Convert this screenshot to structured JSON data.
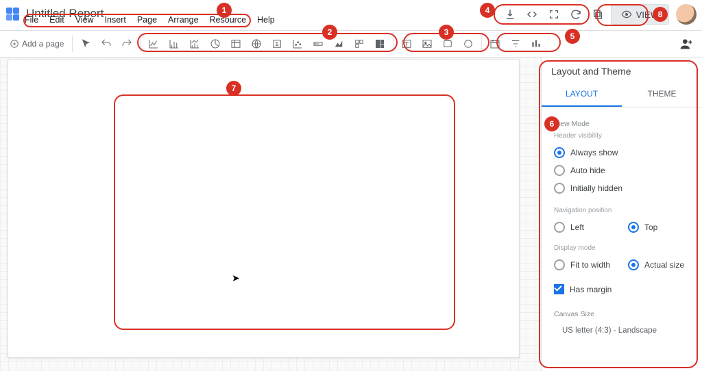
{
  "header": {
    "title": "Untitled Report",
    "menu": [
      "File",
      "Edit",
      "View",
      "Insert",
      "Page",
      "Arrange",
      "Resource",
      "Help"
    ],
    "view_button": "VIEW"
  },
  "toolbar": {
    "add_page": "Add a page"
  },
  "panel": {
    "title": "Layout and Theme",
    "tabs": {
      "layout": "LAYOUT",
      "theme": "THEME"
    },
    "view_mode_label": "View Mode",
    "header_visibility_label": "Header visibility",
    "header_visibility": {
      "always_show": "Always show",
      "auto_hide": "Auto hide",
      "initially_hidden": "Initially hidden"
    },
    "navigation_position_label": "Navigation position",
    "navigation_position": {
      "left": "Left",
      "top": "Top"
    },
    "display_mode_label": "Display mode",
    "display_mode": {
      "fit": "Fit to width",
      "actual": "Actual size"
    },
    "has_margin": "Has margin",
    "canvas_size_label": "Canvas Size",
    "canvas_size_value": "US letter (4:3) - Landscape"
  },
  "annotations": {
    "1": "1",
    "2": "2",
    "3": "3",
    "4": "4",
    "5": "5",
    "6": "6",
    "7": "7",
    "8": "8"
  }
}
